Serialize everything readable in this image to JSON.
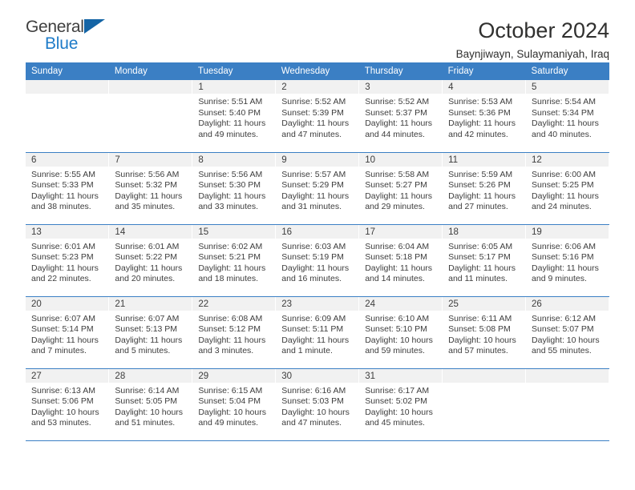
{
  "brand": {
    "name_part1": "General",
    "name_part2": "Blue",
    "accent_color": "#1e7bc8",
    "triangle_color": "#1464a5"
  },
  "header": {
    "title": "October 2024",
    "subtitle": "Baynjiwayn, Sulaymaniyah, Iraq"
  },
  "theme": {
    "header_row_color": "#3b7fc4",
    "daynum_band_color": "#f1f1f1",
    "text_color": "#3d3d3d"
  },
  "weekdays": [
    "Sunday",
    "Monday",
    "Tuesday",
    "Wednesday",
    "Thursday",
    "Friday",
    "Saturday"
  ],
  "weeks": [
    [
      {
        "empty": true
      },
      {
        "empty": true
      },
      {
        "day": "1",
        "sunrise": "Sunrise: 5:51 AM",
        "sunset": "Sunset: 5:40 PM",
        "daylight": "Daylight: 11 hours and 49 minutes."
      },
      {
        "day": "2",
        "sunrise": "Sunrise: 5:52 AM",
        "sunset": "Sunset: 5:39 PM",
        "daylight": "Daylight: 11 hours and 47 minutes."
      },
      {
        "day": "3",
        "sunrise": "Sunrise: 5:52 AM",
        "sunset": "Sunset: 5:37 PM",
        "daylight": "Daylight: 11 hours and 44 minutes."
      },
      {
        "day": "4",
        "sunrise": "Sunrise: 5:53 AM",
        "sunset": "Sunset: 5:36 PM",
        "daylight": "Daylight: 11 hours and 42 minutes."
      },
      {
        "day": "5",
        "sunrise": "Sunrise: 5:54 AM",
        "sunset": "Sunset: 5:34 PM",
        "daylight": "Daylight: 11 hours and 40 minutes."
      }
    ],
    [
      {
        "day": "6",
        "sunrise": "Sunrise: 5:55 AM",
        "sunset": "Sunset: 5:33 PM",
        "daylight": "Daylight: 11 hours and 38 minutes."
      },
      {
        "day": "7",
        "sunrise": "Sunrise: 5:56 AM",
        "sunset": "Sunset: 5:32 PM",
        "daylight": "Daylight: 11 hours and 35 minutes."
      },
      {
        "day": "8",
        "sunrise": "Sunrise: 5:56 AM",
        "sunset": "Sunset: 5:30 PM",
        "daylight": "Daylight: 11 hours and 33 minutes."
      },
      {
        "day": "9",
        "sunrise": "Sunrise: 5:57 AM",
        "sunset": "Sunset: 5:29 PM",
        "daylight": "Daylight: 11 hours and 31 minutes."
      },
      {
        "day": "10",
        "sunrise": "Sunrise: 5:58 AM",
        "sunset": "Sunset: 5:27 PM",
        "daylight": "Daylight: 11 hours and 29 minutes."
      },
      {
        "day": "11",
        "sunrise": "Sunrise: 5:59 AM",
        "sunset": "Sunset: 5:26 PM",
        "daylight": "Daylight: 11 hours and 27 minutes."
      },
      {
        "day": "12",
        "sunrise": "Sunrise: 6:00 AM",
        "sunset": "Sunset: 5:25 PM",
        "daylight": "Daylight: 11 hours and 24 minutes."
      }
    ],
    [
      {
        "day": "13",
        "sunrise": "Sunrise: 6:01 AM",
        "sunset": "Sunset: 5:23 PM",
        "daylight": "Daylight: 11 hours and 22 minutes."
      },
      {
        "day": "14",
        "sunrise": "Sunrise: 6:01 AM",
        "sunset": "Sunset: 5:22 PM",
        "daylight": "Daylight: 11 hours and 20 minutes."
      },
      {
        "day": "15",
        "sunrise": "Sunrise: 6:02 AM",
        "sunset": "Sunset: 5:21 PM",
        "daylight": "Daylight: 11 hours and 18 minutes."
      },
      {
        "day": "16",
        "sunrise": "Sunrise: 6:03 AM",
        "sunset": "Sunset: 5:19 PM",
        "daylight": "Daylight: 11 hours and 16 minutes."
      },
      {
        "day": "17",
        "sunrise": "Sunrise: 6:04 AM",
        "sunset": "Sunset: 5:18 PM",
        "daylight": "Daylight: 11 hours and 14 minutes."
      },
      {
        "day": "18",
        "sunrise": "Sunrise: 6:05 AM",
        "sunset": "Sunset: 5:17 PM",
        "daylight": "Daylight: 11 hours and 11 minutes."
      },
      {
        "day": "19",
        "sunrise": "Sunrise: 6:06 AM",
        "sunset": "Sunset: 5:16 PM",
        "daylight": "Daylight: 11 hours and 9 minutes."
      }
    ],
    [
      {
        "day": "20",
        "sunrise": "Sunrise: 6:07 AM",
        "sunset": "Sunset: 5:14 PM",
        "daylight": "Daylight: 11 hours and 7 minutes."
      },
      {
        "day": "21",
        "sunrise": "Sunrise: 6:07 AM",
        "sunset": "Sunset: 5:13 PM",
        "daylight": "Daylight: 11 hours and 5 minutes."
      },
      {
        "day": "22",
        "sunrise": "Sunrise: 6:08 AM",
        "sunset": "Sunset: 5:12 PM",
        "daylight": "Daylight: 11 hours and 3 minutes."
      },
      {
        "day": "23",
        "sunrise": "Sunrise: 6:09 AM",
        "sunset": "Sunset: 5:11 PM",
        "daylight": "Daylight: 11 hours and 1 minute."
      },
      {
        "day": "24",
        "sunrise": "Sunrise: 6:10 AM",
        "sunset": "Sunset: 5:10 PM",
        "daylight": "Daylight: 10 hours and 59 minutes."
      },
      {
        "day": "25",
        "sunrise": "Sunrise: 6:11 AM",
        "sunset": "Sunset: 5:08 PM",
        "daylight": "Daylight: 10 hours and 57 minutes."
      },
      {
        "day": "26",
        "sunrise": "Sunrise: 6:12 AM",
        "sunset": "Sunset: 5:07 PM",
        "daylight": "Daylight: 10 hours and 55 minutes."
      }
    ],
    [
      {
        "day": "27",
        "sunrise": "Sunrise: 6:13 AM",
        "sunset": "Sunset: 5:06 PM",
        "daylight": "Daylight: 10 hours and 53 minutes."
      },
      {
        "day": "28",
        "sunrise": "Sunrise: 6:14 AM",
        "sunset": "Sunset: 5:05 PM",
        "daylight": "Daylight: 10 hours and 51 minutes."
      },
      {
        "day": "29",
        "sunrise": "Sunrise: 6:15 AM",
        "sunset": "Sunset: 5:04 PM",
        "daylight": "Daylight: 10 hours and 49 minutes."
      },
      {
        "day": "30",
        "sunrise": "Sunrise: 6:16 AM",
        "sunset": "Sunset: 5:03 PM",
        "daylight": "Daylight: 10 hours and 47 minutes."
      },
      {
        "day": "31",
        "sunrise": "Sunrise: 6:17 AM",
        "sunset": "Sunset: 5:02 PM",
        "daylight": "Daylight: 10 hours and 45 minutes."
      },
      {
        "empty": true
      },
      {
        "empty": true
      }
    ]
  ]
}
